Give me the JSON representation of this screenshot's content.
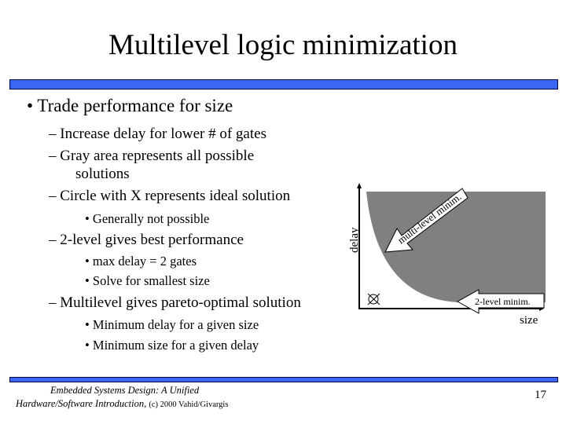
{
  "slide": {
    "title": "Multilevel logic minimization",
    "bullets": {
      "b1": "• Trade performance for size",
      "b1_1": "– Increase delay for lower # of gates",
      "b1_2a": "– Gray area represents all possible",
      "b1_2b": "solutions",
      "b1_3": "– Circle with X represents ideal solution",
      "b1_3_1": "• Generally not possible",
      "b1_4": "– 2-level gives best performance",
      "b1_4_1": "• max delay = 2 gates",
      "b1_4_2": "• Solve for smallest size",
      "b1_5": "– Multilevel gives pareto-optimal solution",
      "b1_5_1": "• Minimum delay for a given size",
      "b1_5_2": "• Minimum size for a given delay"
    },
    "diagram": {
      "y_label": "delay",
      "x_label": "size",
      "arrow_multi": "multi-level minim.",
      "arrow_two": "2-level minim.",
      "ideal_marker_icon": "circle-x-icon",
      "region_color": "#808080"
    },
    "footer": {
      "line1": "Embedded Systems Design: A Unified",
      "line2": "Hardware/Software Introduction,",
      "copyright": "(c) 2000 Vahid/Givargis",
      "page": "17"
    },
    "colors": {
      "bar": "#3a66f4",
      "bar_border": "#000a40"
    }
  }
}
